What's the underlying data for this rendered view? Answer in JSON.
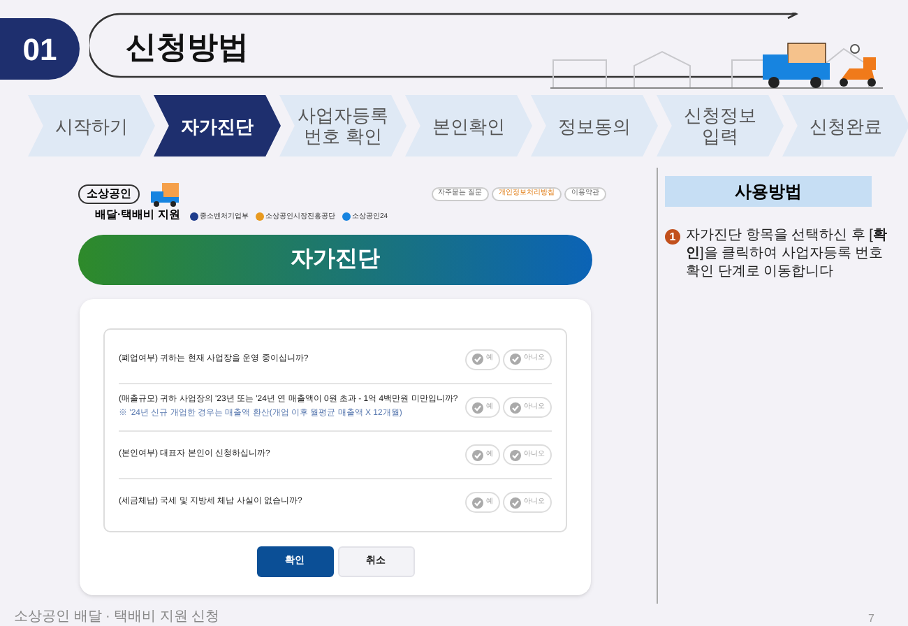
{
  "section": {
    "number": "01",
    "title": "신청방법"
  },
  "steps": [
    {
      "label": "시작하기",
      "selected": false
    },
    {
      "label": "자가진단",
      "selected": true
    },
    {
      "label": "사업자등록\n번호 확인",
      "selected": false
    },
    {
      "label": "본인확인",
      "selected": false
    },
    {
      "label": "정보동의",
      "selected": false
    },
    {
      "label": "신청정보\n입력",
      "selected": false
    },
    {
      "label": "신청완료",
      "selected": false
    }
  ],
  "screenshot": {
    "logo": {
      "badge": "소상공인",
      "subtitle": "배달·택배비 지원"
    },
    "agencies": [
      "중소벤처기업부",
      "소상공인시장진흥공단",
      "소상공인24"
    ],
    "top_links": [
      {
        "label": "자주묻는 질문",
        "highlighted": false
      },
      {
        "label": "개인정보처리방침",
        "highlighted": true
      },
      {
        "label": "이용약관",
        "highlighted": false
      }
    ],
    "banner": "자가진단",
    "questions": [
      {
        "text": "(폐업여부) 귀하는 현재 사업장을 운영 중이십니까?",
        "options": [
          {
            "label": "예",
            "selected": false
          },
          {
            "label": "아니오",
            "selected": false
          }
        ]
      },
      {
        "text": "(매출규모) 귀하 사업장의 '23년 또는 '24년 연 매출액이 0원 초과 - 1억 4백만원 미만입니까?",
        "note": "※ '24년 신규 개업한 경우는 매출액 환산(개업 이후 월평균 매출액 X 12개월)",
        "options": [
          {
            "label": "예",
            "selected": false
          },
          {
            "label": "아니오",
            "selected": false
          }
        ]
      },
      {
        "text": "(본인여부) 대표자 본인이 신청하십니까?",
        "options": [
          {
            "label": "예",
            "selected": false
          },
          {
            "label": "아니오",
            "selected": false
          }
        ]
      },
      {
        "text": "(세금체납) 국세 및 지방세 체납 사실이 없습니까?",
        "options": [
          {
            "label": "예",
            "selected": false
          },
          {
            "label": "아니오",
            "selected": false
          }
        ]
      }
    ],
    "buttons": [
      {
        "label": "확인",
        "kind": "primary"
      },
      {
        "label": "취소",
        "kind": "secondary"
      }
    ]
  },
  "usage": {
    "title": "사용방법",
    "steps": [
      {
        "number": "1",
        "text": "자가진단 항목을 선택하신 후 [**확인**]을 클릭하여 사업자등록 번호 확인 단계로 이동합니다"
      }
    ]
  },
  "footer": {
    "title": "소상공인 배달 · 택배비 지원 신청",
    "page": "7"
  }
}
